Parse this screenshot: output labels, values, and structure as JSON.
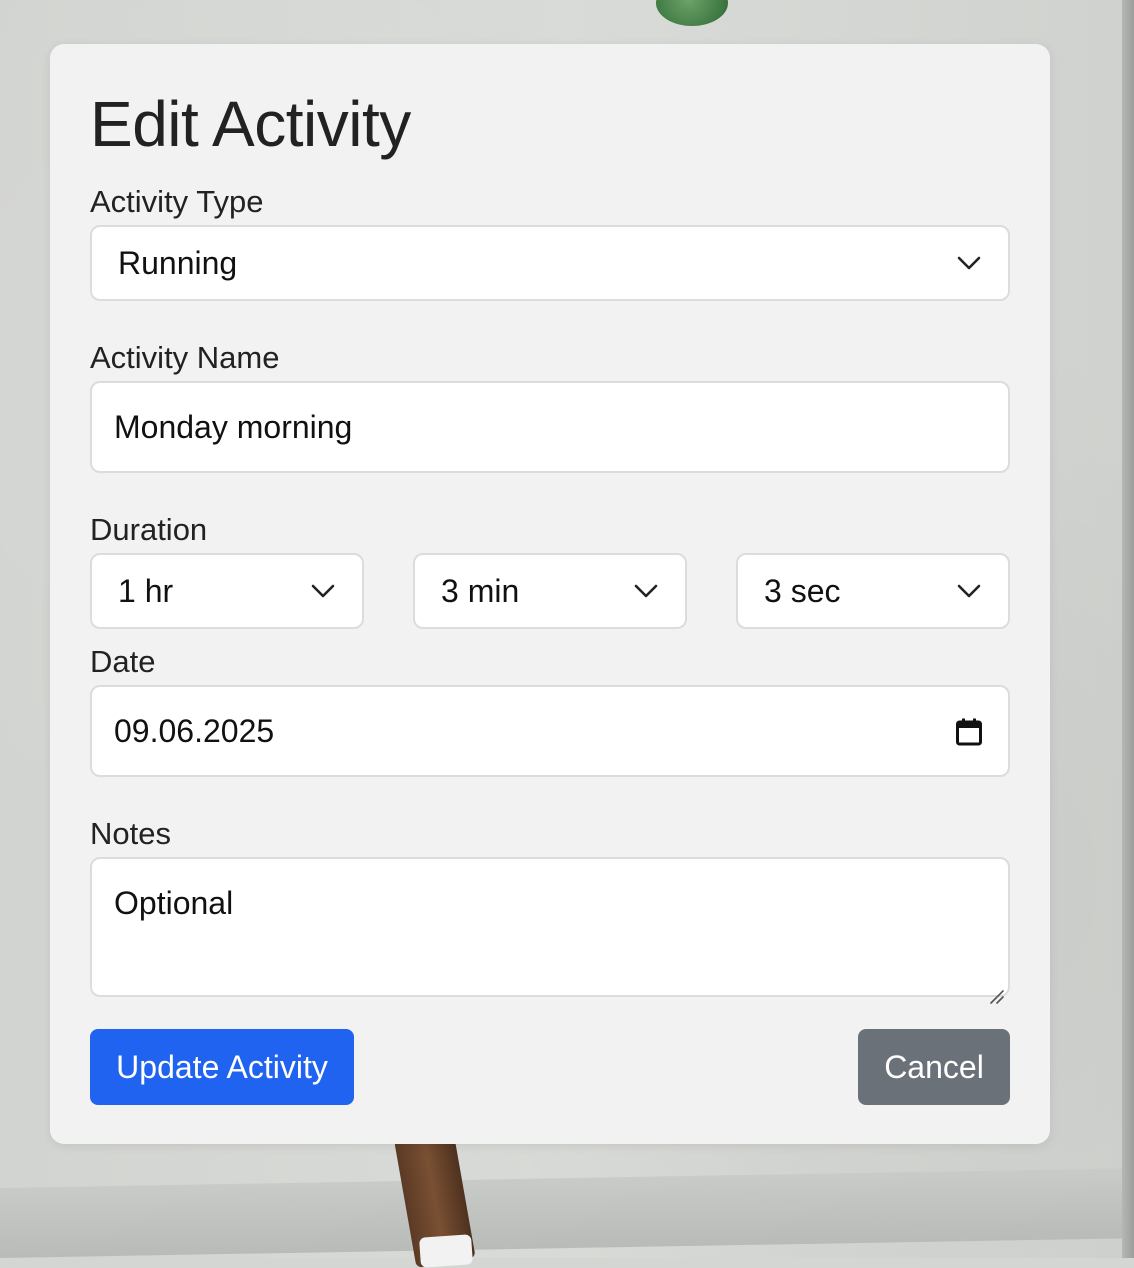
{
  "form": {
    "title": "Edit Activity",
    "activity_type": {
      "label": "Activity Type",
      "value": "Running"
    },
    "activity_name": {
      "label": "Activity Name",
      "value": "Monday morning"
    },
    "duration": {
      "label": "Duration",
      "hours": "1 hr",
      "minutes": "3 min",
      "seconds": "3 sec"
    },
    "date": {
      "label": "Date",
      "value": "09.06.2025"
    },
    "notes": {
      "label": "Notes",
      "placeholder": "Optional"
    },
    "buttons": {
      "update": "Update Activity",
      "cancel": "Cancel"
    }
  },
  "colors": {
    "primary": "#1f63f0",
    "secondary": "#6b7178",
    "card_bg": "#f2f2f2"
  },
  "icons": {
    "select": "chevron-down-icon",
    "date": "calendar-icon",
    "notes": "resize-handle-icon"
  }
}
